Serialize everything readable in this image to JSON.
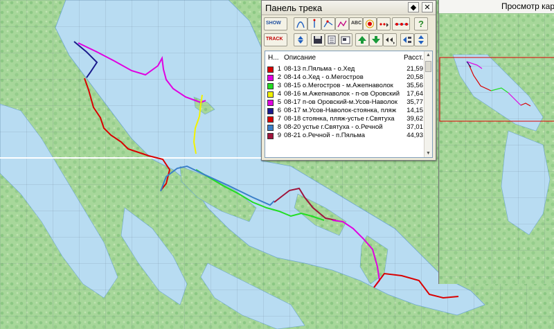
{
  "panel": {
    "title": "Панель трека",
    "dropdown_glyph": "◆",
    "close_glyph": "✕",
    "toolbar_row1": [
      "show-track-icon",
      "curve-icon",
      "vertical-line-icon",
      "node-edit-icon",
      "path-icon",
      "abc-label-icon",
      "point-color-icon",
      "dots-icon",
      "help-icon",
      "download-icon"
    ],
    "toolbar_row2": [
      "track-icon",
      "up-down-icon",
      "save-icon",
      "list-icon",
      "export-icon",
      "arrow-up-icon",
      "arrow-down-icon",
      "arrow-menu-icon",
      "split-icon",
      "sort-icon"
    ],
    "show_label": "SHOW",
    "track_label": "TRACK",
    "abc_label": "ABC",
    "help_label": "?",
    "columns": {
      "number": "Н...",
      "description": "Описание",
      "distance": "Расст."
    },
    "rows": [
      {
        "n": "1",
        "desc": "08-13 п.Пяльма - о.Хед",
        "dist": "21,59",
        "color": "#d90000"
      },
      {
        "n": "2",
        "desc": "08-14 о.Хед - о.Мегостров",
        "dist": "20,58",
        "color": "#e000e0"
      },
      {
        "n": "3",
        "desc": "08-15 о.Мегостров - м.Ажепнаволок",
        "dist": "35,56",
        "color": "#22dd22"
      },
      {
        "n": "4",
        "desc": "08-16 м.Ажепнаволок - п-ов Оровский",
        "dist": "17,64",
        "color": "#f2f200"
      },
      {
        "n": "5",
        "desc": "08-17 п-ов Оровский-м.Усов-Наволок",
        "dist": "35,77",
        "color": "#e000e0"
      },
      {
        "n": "6",
        "desc": "08-17 м.Усов-Наволок-стоянка, пляж",
        "dist": "14,15",
        "color": "#1a1a8c"
      },
      {
        "n": "7",
        "desc": "08-18 стоянка, пляж-устье г.Святуха",
        "dist": "39,62",
        "color": "#d90000"
      },
      {
        "n": "8",
        "desc": "08-20 устье г.Святуха - о.Речной",
        "dist": "37,01",
        "color": "#3a7fc8"
      },
      {
        "n": "9",
        "desc": "08-21 о.Речной - п.Пяльма",
        "dist": "44,93",
        "color": "#a0143c"
      }
    ]
  },
  "overview": {
    "title": "Просмотр кар"
  },
  "map": {
    "tracks": [
      {
        "name": "08-13 п.Пяльма - о.Хед",
        "color": "#d90000"
      },
      {
        "name": "08-14 о.Хед - о.Мегостров",
        "color": "#e000e0"
      },
      {
        "name": "08-15 о.Мегостров - м.Ажепнаволок",
        "color": "#22dd22"
      },
      {
        "name": "08-16 м.Ажепнаволок - п-ов Оровский",
        "color": "#f2f200"
      },
      {
        "name": "08-17 п-ов Оровский-м.Усов-Наволок",
        "color": "#e000e0"
      },
      {
        "name": "08-17 м.Усов-Наволок-стоянка, пляж",
        "color": "#1a1a8c"
      },
      {
        "name": "08-18 стоянка, пляж-устье г.Святуха",
        "color": "#d90000"
      },
      {
        "name": "08-20 устье г.Святуха - о.Речной",
        "color": "#3a7fc8"
      },
      {
        "name": "08-21 о.Речной - п.Пяльма",
        "color": "#a0143c"
      }
    ]
  }
}
